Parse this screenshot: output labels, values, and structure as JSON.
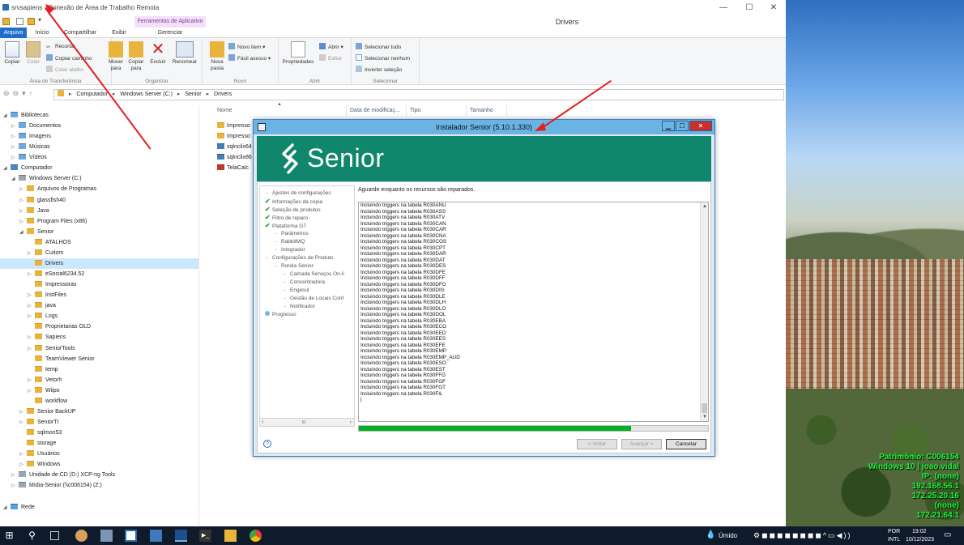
{
  "window": {
    "title": "srvsapiens - Conexão de Área de Trabalho Remota",
    "controls": [
      "—",
      "☐",
      "✕"
    ]
  },
  "explorer": {
    "folder_title": "Drivers",
    "contextual_tab": "Ferramentas de Aplicativo",
    "tabs": [
      "Arquivo",
      "Início",
      "Compartilhar",
      "Exibir",
      "Gerenciar"
    ],
    "ribbon": {
      "clipboard": {
        "label": "Área de Transferência",
        "copy": "Copiar",
        "paste": "Colar",
        "cut": "Recortar",
        "copy_path": "Copiar caminho",
        "paste_shortcut": "Colar atalho"
      },
      "organize": {
        "label": "Organizar",
        "move_to": "Mover para",
        "copy_to": "Copiar para",
        "delete": "Excluir",
        "rename": "Renomear"
      },
      "new": {
        "label": "Novo",
        "new_folder": "Nova pasta",
        "new_item": "Novo item",
        "easy_access": "Fácil acesso"
      },
      "open": {
        "label": "Abrir",
        "properties": "Propriedades",
        "open": "Abrir",
        "edit": "Editar"
      },
      "select": {
        "label": "Selecionar",
        "select_all": "Selecionar tudo",
        "select_none": "Selecionar nenhum",
        "invert": "Inverter seleção"
      }
    },
    "address": [
      "Computador",
      "Windows Server (C:)",
      "Senior",
      "Drivers"
    ],
    "columns": [
      "Nome",
      "Data de modificaç...",
      "Tipo",
      "Tamanho"
    ],
    "files": [
      "Impresso",
      "Impresso",
      "sqlnclix64",
      "sqlnclix86",
      "TelaCalc"
    ],
    "tree": [
      {
        "label": "Bibliotecas",
        "level": 0,
        "expander": "◢",
        "icon": "blue"
      },
      {
        "label": "Documentos",
        "level": 1,
        "expander": "▷",
        "icon": "blue"
      },
      {
        "label": "Imagens",
        "level": 1,
        "expander": "▷",
        "icon": "blue"
      },
      {
        "label": "Músicas",
        "level": 1,
        "expander": "▷",
        "icon": "blue"
      },
      {
        "label": "Vídeos",
        "level": 1,
        "expander": "▷",
        "icon": "blue"
      },
      {
        "label": "Computador",
        "level": 0,
        "expander": "◢",
        "icon": "pc"
      },
      {
        "label": "Windows Server (C:)",
        "level": 1,
        "expander": "◢",
        "icon": "drv"
      },
      {
        "label": "Arquivos de Programas",
        "level": 2,
        "expander": "▷",
        "icon": "folder"
      },
      {
        "label": "glassfish40",
        "level": 2,
        "expander": "▷",
        "icon": "folder"
      },
      {
        "label": "Java",
        "level": 2,
        "expander": "▷",
        "icon": "folder"
      },
      {
        "label": "Program Files (x86)",
        "level": 2,
        "expander": "▷",
        "icon": "folder"
      },
      {
        "label": "Senior",
        "level": 2,
        "expander": "◢",
        "icon": "folder"
      },
      {
        "label": "ATALHOS",
        "level": 3,
        "expander": "",
        "icon": "folder"
      },
      {
        "label": "Cuitom",
        "level": 3,
        "expander": "▷",
        "icon": "folder"
      },
      {
        "label": "Drivers",
        "level": 3,
        "expander": "",
        "icon": "folder",
        "selected": true
      },
      {
        "label": "eSocial6234.52",
        "level": 3,
        "expander": "▷",
        "icon": "folder"
      },
      {
        "label": "Impressoras",
        "level": 3,
        "expander": "",
        "icon": "folder"
      },
      {
        "label": "InstFiles",
        "level": 3,
        "expander": "▷",
        "icon": "folder"
      },
      {
        "label": "java",
        "level": 3,
        "expander": "▷",
        "icon": "folder"
      },
      {
        "label": "Logs",
        "level": 3,
        "expander": "▷",
        "icon": "folder"
      },
      {
        "label": "Proprietarias OLD",
        "level": 3,
        "expander": "",
        "icon": "folder"
      },
      {
        "label": "Sapiens",
        "level": 3,
        "expander": "▷",
        "icon": "folder"
      },
      {
        "label": "SeniorTools",
        "level": 3,
        "expander": "▷",
        "icon": "folder"
      },
      {
        "label": "TeamViewer Senior",
        "level": 3,
        "expander": "",
        "icon": "folder"
      },
      {
        "label": "temp",
        "level": 3,
        "expander": "",
        "icon": "folder"
      },
      {
        "label": "Vetorh",
        "level": 3,
        "expander": "▷",
        "icon": "folder"
      },
      {
        "label": "Wiipo",
        "level": 3,
        "expander": "▷",
        "icon": "folder"
      },
      {
        "label": "workflow",
        "level": 3,
        "expander": "",
        "icon": "folder"
      },
      {
        "label": "Senior BackUP",
        "level": 2,
        "expander": "▷",
        "icon": "folder"
      },
      {
        "label": "SeniorTI",
        "level": 2,
        "expander": "▷",
        "icon": "folder"
      },
      {
        "label": "sqlmon53",
        "level": 2,
        "expander": "",
        "icon": "folder"
      },
      {
        "label": "storage",
        "level": 2,
        "expander": "",
        "icon": "folder"
      },
      {
        "label": "Usuários",
        "level": 2,
        "expander": "▷",
        "icon": "folder"
      },
      {
        "label": "Windows",
        "level": 2,
        "expander": "▷",
        "icon": "folder"
      },
      {
        "label": "Unidade de CD (D:) XCP-ng Tools",
        "level": 1,
        "expander": "▷",
        "icon": "drv"
      },
      {
        "label": "Mídia-Senior (\\\\c006154) (Z:)",
        "level": 1,
        "expander": "▷",
        "icon": "drv"
      },
      {
        "label": "",
        "level": 0,
        "expander": "",
        "icon": "none"
      },
      {
        "label": "Rede",
        "level": 0,
        "expander": "◢",
        "icon": "net"
      }
    ]
  },
  "installer": {
    "title": "Instalador Senior (5.10.1.330)",
    "logo_text": "Senior",
    "status": "Aguarde enquanto os recursos são reparados.",
    "steps": [
      {
        "label": "Ajustes de configurações",
        "indent": 0,
        "state": "pending"
      },
      {
        "label": "Informações da cópia",
        "indent": 0,
        "state": "done"
      },
      {
        "label": "Seleção de produtos",
        "indent": 0,
        "state": "done"
      },
      {
        "label": "Filtro de reparo",
        "indent": 0,
        "state": "done"
      },
      {
        "label": "Plataforma G7",
        "indent": 0,
        "state": "done"
      },
      {
        "label": "Parâmetros",
        "indent": 1,
        "state": "pending"
      },
      {
        "label": "RabbitMQ",
        "indent": 1,
        "state": "pending"
      },
      {
        "label": "Integrador",
        "indent": 1,
        "state": "pending"
      },
      {
        "label": "Configurações de Produto",
        "indent": 0,
        "state": "pending"
      },
      {
        "label": "Ronda Senior",
        "indent": 1,
        "state": "pending"
      },
      {
        "label": "Camada Serviços On-li",
        "indent": 2,
        "state": "pending"
      },
      {
        "label": "Concentradora",
        "indent": 2,
        "state": "pending"
      },
      {
        "label": "Engesul",
        "indent": 2,
        "state": "pending"
      },
      {
        "label": "Gestão de Locais Conf",
        "indent": 2,
        "state": "pending"
      },
      {
        "label": "Notificador",
        "indent": 2,
        "state": "pending"
      },
      {
        "label": "Progresso",
        "indent": 0,
        "state": "current"
      }
    ],
    "log": [
      "Incluindo triggers na tabela R030ANU",
      "Incluindo triggers na tabela R030ASS",
      "Incluindo triggers na tabela R030ATV",
      "Incluindo triggers na tabela R030CAN",
      "Incluindo triggers na tabela R030CAR",
      "Incluindo triggers na tabela R030CNA",
      "Incluindo triggers na tabela R030COS",
      "Incluindo triggers na tabela R030CPT",
      "Incluindo triggers na tabela R030DAR",
      "Incluindo triggers na tabela R030DAT",
      "Incluindo triggers na tabela R030DES",
      "Incluindo triggers na tabela R030DFE",
      "Incluindo triggers na tabela R030DFF",
      "Incluindo triggers na tabela R030DFO",
      "Incluindo triggers na tabela R030DIG",
      "Incluindo triggers na tabela R030DLE",
      "Incluindo triggers na tabela R030DLH",
      "Incluindo triggers na tabela R030DLO",
      "Incluindo triggers na tabela R030DOL",
      "Incluindo triggers na tabela R030EBA",
      "Incluindo triggers na tabela R030ECO",
      "Incluindo triggers na tabela R030EED",
      "Incluindo triggers na tabela R030EES",
      "Incluindo triggers na tabela R030EFE",
      "Incluindo triggers na tabela R030EMP",
      "Incluindo triggers na tabela R030EMP_AUD",
      "Incluindo triggers na tabela R030ESO",
      "Incluindo triggers na tabela R030EST",
      "Incluindo triggers na tabela R030FFG",
      "Incluindo triggers na tabela R030FGF",
      "Incluindo triggers na tabela R030FGT",
      "Incluindo triggers na tabela R030FIL",
      "|"
    ],
    "progress_fraction": 0.78,
    "buttons": {
      "back": "< Voltar",
      "next": "Avançar >",
      "cancel": "Cancelar"
    },
    "scroll_thumb": "III"
  },
  "desktop_info": [
    "Patrimônio: C006154",
    "Windows 10 | joao.vidal",
    "IP: (none)",
    "192.168.56.1",
    "172.25.20.16",
    "(none)",
    "172.21.64.1"
  ],
  "taskbar": {
    "weather": "Úmido",
    "language": "POR",
    "layout": "INTL",
    "time": "19:02",
    "date": "10/12/2023"
  },
  "colors": {
    "senior_green": "#10876d",
    "progress_green": "#06b025",
    "info_green": "#1cf63a",
    "title_blue": "#6ab4e4",
    "arrow_red": "#e32020"
  }
}
